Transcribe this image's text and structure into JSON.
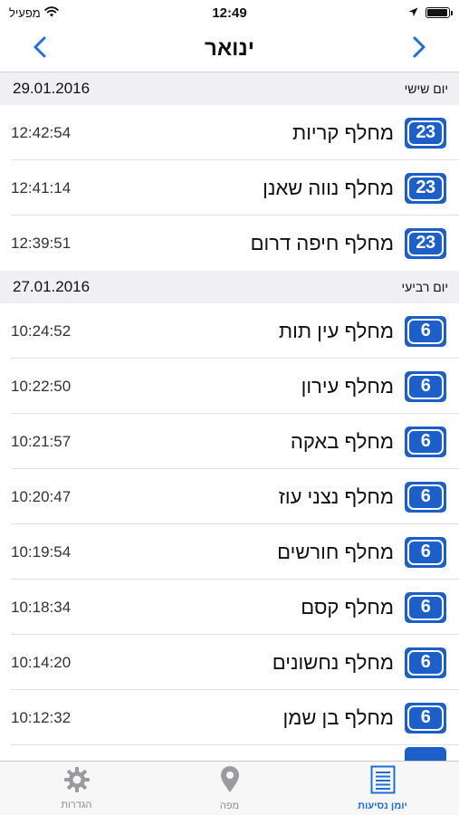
{
  "status_bar": {
    "carrier": "מפעיל",
    "time": "12:49",
    "battery_level": 0.95
  },
  "nav": {
    "title": "ינואר",
    "prev_icon": "chevron-left-icon",
    "next_icon": "chevron-right-icon"
  },
  "sections": [
    {
      "date": "29.01.2016",
      "day": "יום שישי",
      "rows": [
        {
          "route": "23",
          "label": "מחלף קריות",
          "time": "12:42:54"
        },
        {
          "route": "23",
          "label": "מחלף נווה שאנן",
          "time": "12:41:14"
        },
        {
          "route": "23",
          "label": "מחלף חיפה דרום",
          "time": "12:39:51"
        }
      ]
    },
    {
      "date": "27.01.2016",
      "day": "יום רביעי",
      "rows": [
        {
          "route": "6",
          "label": "מחלף עין תות",
          "time": "10:24:52"
        },
        {
          "route": "6",
          "label": "מחלף עירון",
          "time": "10:22:50"
        },
        {
          "route": "6",
          "label": "מחלף באקה",
          "time": "10:21:57"
        },
        {
          "route": "6",
          "label": "מחלף נצני עוז",
          "time": "10:20:47"
        },
        {
          "route": "6",
          "label": "מחלף חורשים",
          "time": "10:19:54"
        },
        {
          "route": "6",
          "label": "מחלף קסם",
          "time": "10:18:34"
        },
        {
          "route": "6",
          "label": "מחלף נחשונים",
          "time": "10:14:20"
        },
        {
          "route": "6",
          "label": "מחלף בן שמן",
          "time": "10:12:32"
        }
      ]
    }
  ],
  "tabs": [
    {
      "label": "יומן נסיעות",
      "icon": "list-icon",
      "active": true
    },
    {
      "label": "מפה",
      "icon": "map-pin-icon",
      "active": false
    },
    {
      "label": "הגדרות",
      "icon": "gear-icon",
      "active": false
    }
  ],
  "colors": {
    "accent": "#1f6fd8",
    "badge": "#1c5fc9",
    "section_bg": "#efeff4"
  }
}
